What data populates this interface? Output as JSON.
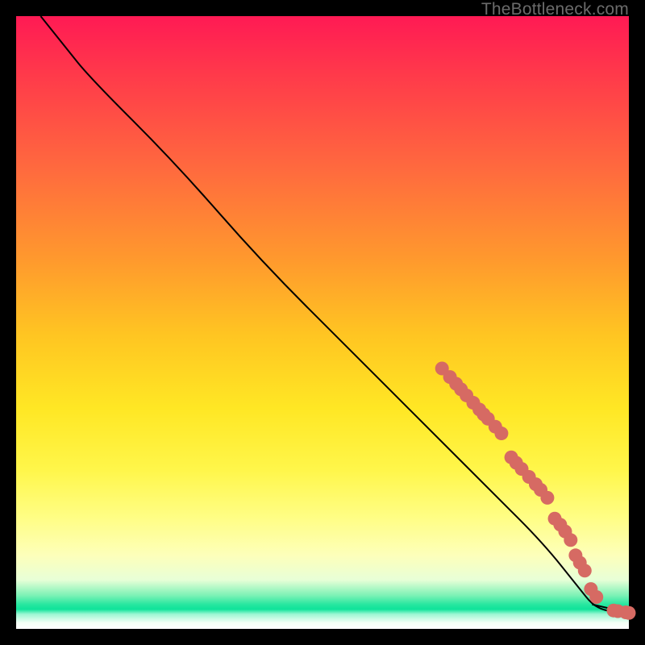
{
  "watermark": "TheBottleneck.com",
  "colors": {
    "dot": "#d66a63",
    "curve": "#000000",
    "frame": "#000000"
  },
  "chart_data": {
    "type": "line",
    "title": "",
    "xlabel": "",
    "ylabel": "",
    "xlim": [
      0,
      100
    ],
    "ylim": [
      0,
      100
    ],
    "grid": false,
    "legend": false,
    "series": [
      {
        "name": "bottleneck-curve",
        "points": [
          {
            "x": 4,
            "y": 100
          },
          {
            "x": 8,
            "y": 95
          },
          {
            "x": 12,
            "y": 90
          },
          {
            "x": 26,
            "y": 76
          },
          {
            "x": 40,
            "y": 60
          },
          {
            "x": 55,
            "y": 45
          },
          {
            "x": 67,
            "y": 33
          },
          {
            "x": 78,
            "y": 22
          },
          {
            "x": 86,
            "y": 14
          },
          {
            "x": 92,
            "y": 6.5
          },
          {
            "x": 94,
            "y": 4
          },
          {
            "x": 96,
            "y": 3
          },
          {
            "x": 98,
            "y": 2.8
          },
          {
            "x": 100,
            "y": 2.6
          }
        ]
      }
    ],
    "markers": [
      {
        "x": 69.5,
        "y": 42.5
      },
      {
        "x": 70.8,
        "y": 41.1
      },
      {
        "x": 71.8,
        "y": 40.0
      },
      {
        "x": 72.6,
        "y": 39.1
      },
      {
        "x": 73.5,
        "y": 38.1
      },
      {
        "x": 74.6,
        "y": 36.9
      },
      {
        "x": 75.6,
        "y": 35.8
      },
      {
        "x": 77.0,
        "y": 34.3
      },
      {
        "x": 78.2,
        "y": 33.0
      },
      {
        "x": 79.2,
        "y": 31.9
      },
      {
        "x": 76.3,
        "y": 35.0
      },
      {
        "x": 80.8,
        "y": 28.0
      },
      {
        "x": 81.6,
        "y": 27.1
      },
      {
        "x": 82.5,
        "y": 26.1
      },
      {
        "x": 83.7,
        "y": 24.8
      },
      {
        "x": 84.8,
        "y": 23.6
      },
      {
        "x": 85.6,
        "y": 22.7
      },
      {
        "x": 86.7,
        "y": 21.4
      },
      {
        "x": 87.9,
        "y": 18.0
      },
      {
        "x": 88.8,
        "y": 17.0
      },
      {
        "x": 89.6,
        "y": 15.9
      },
      {
        "x": 90.5,
        "y": 14.5
      },
      {
        "x": 91.3,
        "y": 12.0
      },
      {
        "x": 92.0,
        "y": 10.8
      },
      {
        "x": 92.8,
        "y": 9.5
      },
      {
        "x": 93.8,
        "y": 6.5
      },
      {
        "x": 94.7,
        "y": 5.2
      },
      {
        "x": 97.5,
        "y": 3.0
      },
      {
        "x": 98.2,
        "y": 2.9
      },
      {
        "x": 99.5,
        "y": 2.7
      },
      {
        "x": 100.0,
        "y": 2.6
      }
    ]
  }
}
